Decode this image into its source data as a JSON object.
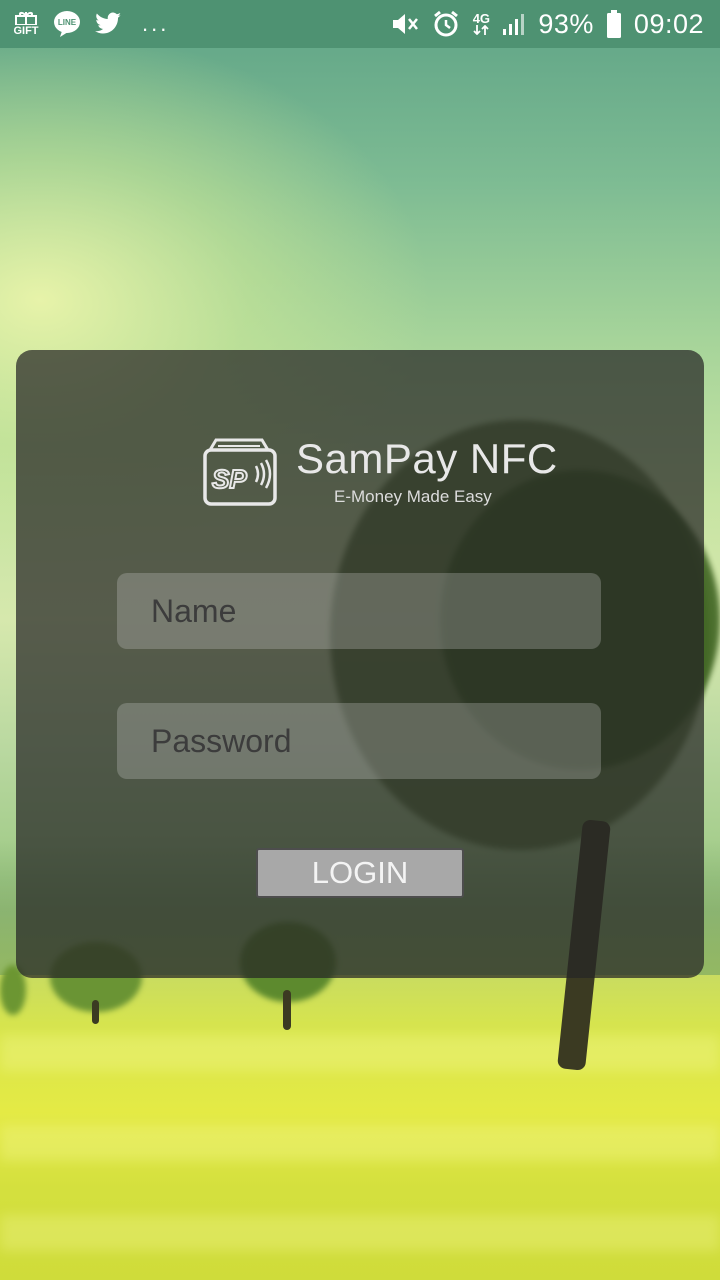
{
  "status_bar": {
    "left_icons": [
      "gift-icon",
      "line-icon",
      "twitter-icon",
      "more-icon"
    ],
    "gift_label": "GIFT",
    "line_label": "LINE",
    "more_label": "...",
    "right_icons": [
      "mute-icon",
      "alarm-icon",
      "network-4g-icon",
      "signal-icon",
      "battery-icon"
    ],
    "network": "4G",
    "battery": "93%",
    "time": "09:02"
  },
  "logo": {
    "badge": "SP",
    "brand": "SamPay NFC",
    "tagline": "E-Money Made Easy"
  },
  "form": {
    "name_placeholder": "Name",
    "password_placeholder": "Password",
    "login_label": "LOGIN"
  },
  "colors": {
    "status_bar": "#4e9272",
    "card": "#262626",
    "button": "#a8a8a8"
  }
}
